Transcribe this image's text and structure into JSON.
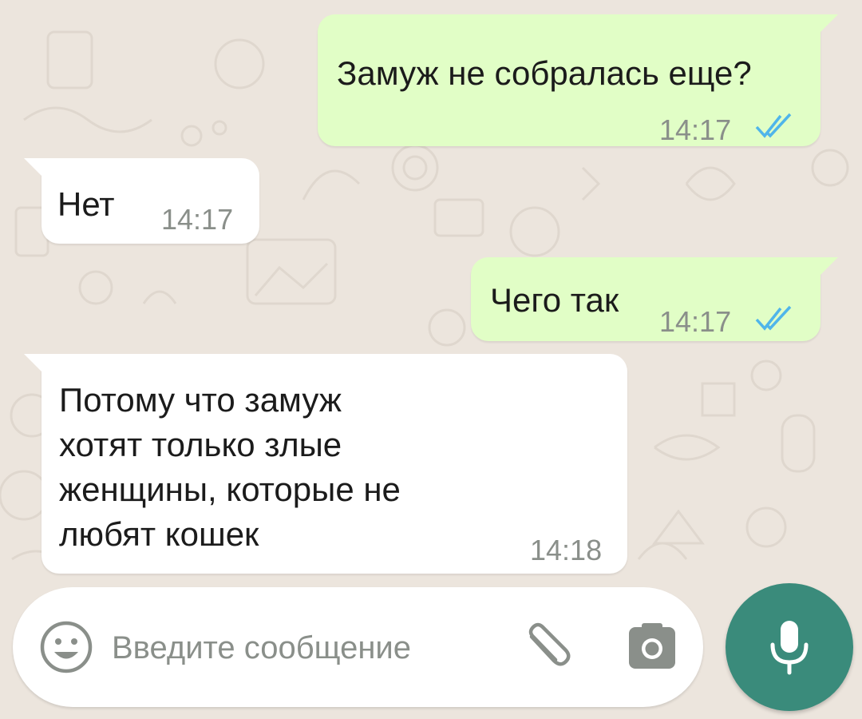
{
  "colors": {
    "wallpaper": "#ece5dd",
    "outgoing_bubble": "#e1fec6",
    "incoming_bubble": "#ffffff",
    "read_ticks": "#4fb5ea",
    "timestamp": "#8a8f8a",
    "mic_button": "#3a8b7b"
  },
  "messages": [
    {
      "direction": "outgoing",
      "text": "Замуж не собралась еще?",
      "time": "14:17",
      "status": "read"
    },
    {
      "direction": "incoming",
      "text": "Нет",
      "time": "14:17"
    },
    {
      "direction": "outgoing",
      "text": "Чего так",
      "time": "14:17",
      "status": "read"
    },
    {
      "direction": "incoming",
      "text": "Потому что замуж\nхотят только злые\nженщины, которые не\nлюбят кошек",
      "time": "14:18"
    }
  ],
  "input_bar": {
    "placeholder": "Введите сообщение",
    "value": "",
    "icons": [
      "emoji-icon",
      "paperclip-icon",
      "camera-icon"
    ]
  },
  "mic_button": {
    "icon": "microphone-icon"
  }
}
